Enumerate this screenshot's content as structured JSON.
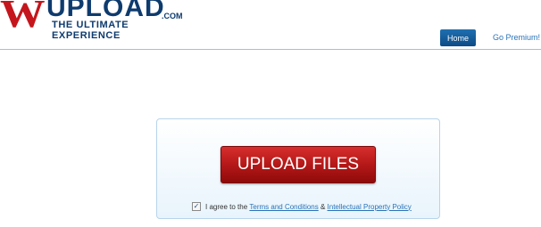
{
  "logo": {
    "w": "W",
    "upload": "UPLOAD",
    "com": ".COM",
    "tagline": "THE ULTIMATE EXPERIENCE"
  },
  "nav": {
    "home": "Home",
    "premium": "Go Premium!"
  },
  "upload": {
    "button_label": "UPLOAD FILES",
    "checkbox_checked": true,
    "agree_prefix": "I agree to the ",
    "terms_link": "Terms and Conditions",
    "amp": " & ",
    "ip_link": "Intellectual Property Policy"
  },
  "colors": {
    "brand_red": "#c4161c",
    "brand_navy": "#0e3b6e",
    "link_blue": "#2a73b8"
  }
}
